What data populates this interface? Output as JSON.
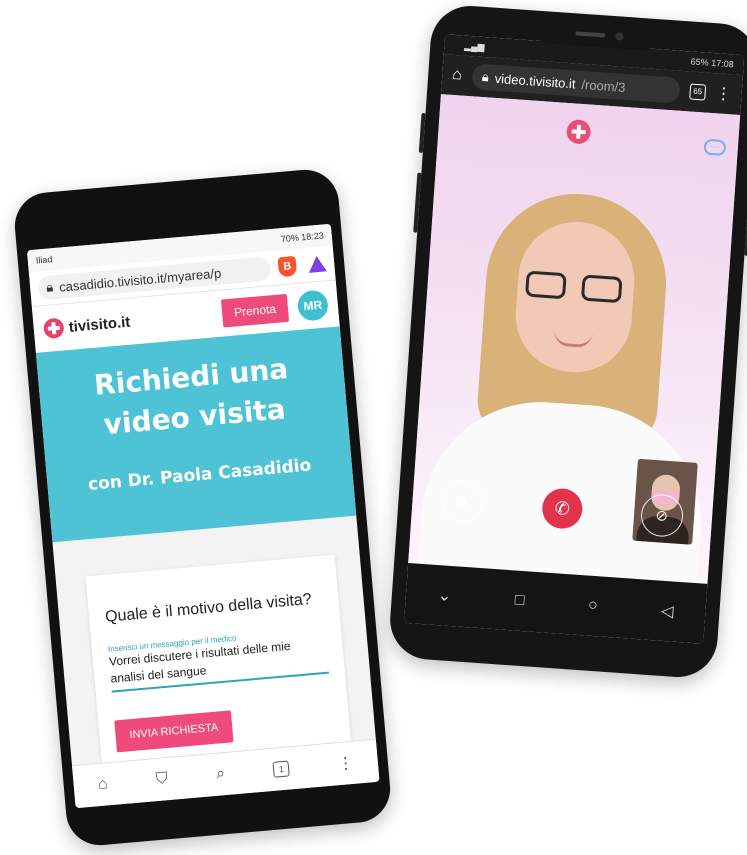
{
  "left_phone": {
    "status_bar": {
      "carrier": "Iliad",
      "battery": "70%",
      "time": "18:23"
    },
    "browser": {
      "url": "casadidio.tivisito.it/myarea/p",
      "brave_icon": "brave-lion-icon",
      "rewards_icon": "triangle-icon"
    },
    "site_header": {
      "logo_text": "tivisito.it",
      "book_button": "Prenota",
      "avatar_initials": "MR"
    },
    "hero": {
      "title": "Richiedi una video visita",
      "subtitle": "con Dr. Paola Casadidio"
    },
    "form": {
      "question": "Quale è il motivo della visita?",
      "field_label": "Inserisci un messaggio per il medico",
      "field_value": "Vorrei discutere i risultati delle mie analisi del sangue",
      "submit_button": "INVIA RICHIESTA"
    },
    "bottom_nav": {
      "tab_count": "1"
    },
    "colors": {
      "accent_pink": "#ee4b7c",
      "hero_teal": "#4fc3d6"
    }
  },
  "right_phone": {
    "status_bar": {
      "battery": "65%",
      "time": "17:08"
    },
    "browser": {
      "url_domain": "video.tivisito.it",
      "url_path": "/room/3",
      "tab_count": "65"
    },
    "call": {
      "camera_icon": "video-camera-icon",
      "end_call_icon": "hang-up-icon",
      "mute_icon": "mic-off-icon"
    },
    "colors": {
      "end_call_red": "#e2334a"
    }
  }
}
